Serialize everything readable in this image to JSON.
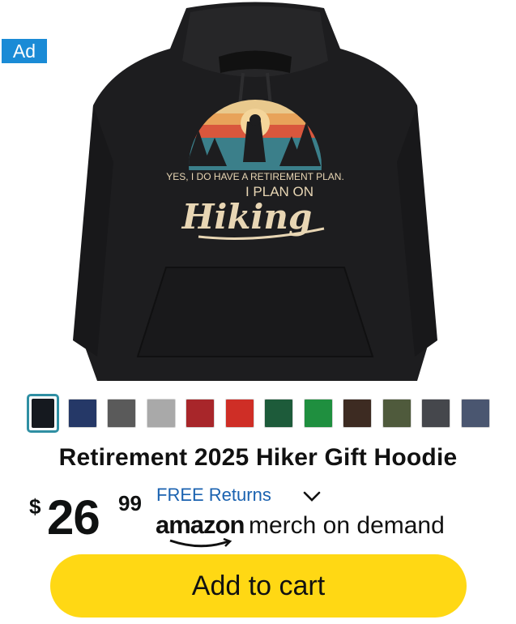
{
  "ad": {
    "label": "Ad"
  },
  "product": {
    "graphic_text_line1": "YES, I DO HAVE A RETIREMENT PLAN.",
    "graphic_text_line2": "I PLAN ON",
    "graphic_text_line3": "Hiking",
    "title": "Retirement 2025 Hiker Gift Hoodie",
    "hoodie_color": "#1d1d1f"
  },
  "swatches": [
    {
      "color": "#15191f",
      "selected": true
    },
    {
      "color": "#253867",
      "selected": false
    },
    {
      "color": "#5a5a5a",
      "selected": false
    },
    {
      "color": "#a9a9a9",
      "selected": false
    },
    {
      "color": "#a8262a",
      "selected": false
    },
    {
      "color": "#cf2e26",
      "selected": false
    },
    {
      "color": "#1d5b3a",
      "selected": false
    },
    {
      "color": "#1f8f3f",
      "selected": false
    },
    {
      "color": "#3d2b22",
      "selected": false
    },
    {
      "color": "#4f5a3c",
      "selected": false
    },
    {
      "color": "#45474c",
      "selected": false
    },
    {
      "color": "#4a5670",
      "selected": false
    }
  ],
  "price": {
    "symbol": "$",
    "whole": "26",
    "fraction": "99"
  },
  "shipping": {
    "returns_label": "FREE Returns"
  },
  "brand": {
    "amazon": "amazon",
    "rest": "merch on demand"
  },
  "actions": {
    "add_to_cart": "Add to cart"
  },
  "colors": {
    "accent_yellow": "#ffd814",
    "link_blue": "#1a62b0",
    "selected_border": "#2f8fa3"
  }
}
